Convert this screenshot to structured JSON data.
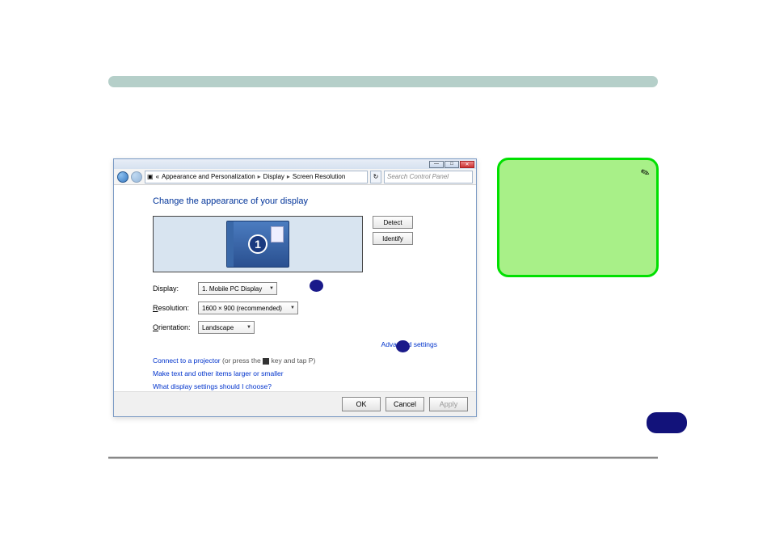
{
  "breadcrumb": {
    "part1": "Appearance and Personalization",
    "part2": "Display",
    "part3": "Screen Resolution"
  },
  "search": {
    "placeholder": "Search Control Panel"
  },
  "header": "Change the appearance of your display",
  "monitor_number": "1",
  "buttons": {
    "detect": "Detect",
    "identify": "Identify",
    "ok": "OK",
    "cancel": "Cancel",
    "apply": "Apply"
  },
  "labels": {
    "display": "Display:",
    "resolution": "Resolution:",
    "orientation": "Orientation:"
  },
  "dropdowns": {
    "display": "1. Mobile PC Display",
    "resolution": "1600 × 900 (recommended)",
    "orientation": "Landscape"
  },
  "links": {
    "advanced": "Advanced settings",
    "projector": "Connect to a projector",
    "projector_hint": " (or press the ",
    "projector_hint2": " key and tap P)",
    "larger": "Make text and other items larger or smaller",
    "which": "What display settings should I choose?"
  }
}
